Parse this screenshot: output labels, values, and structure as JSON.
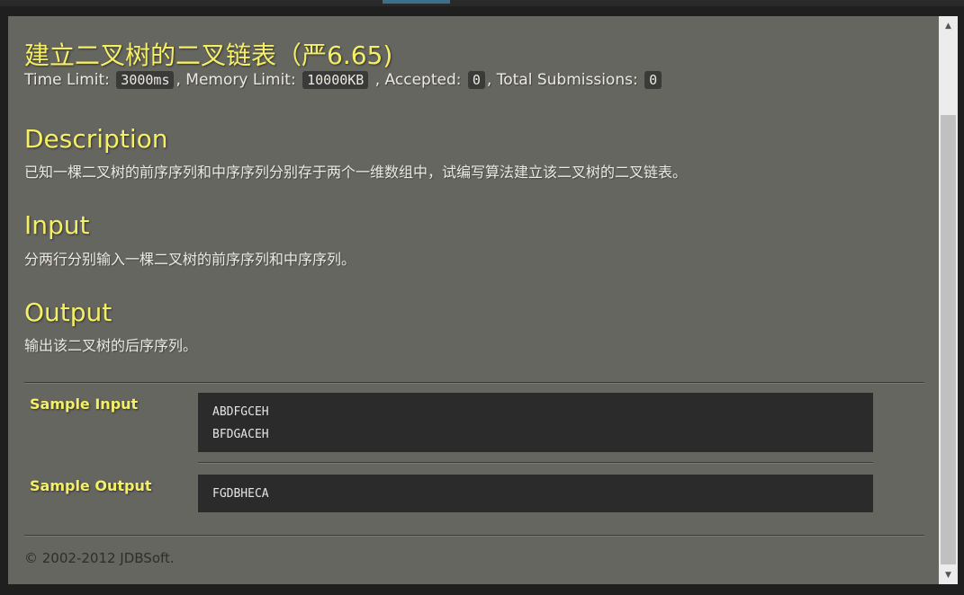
{
  "problem": {
    "title": "建立二叉树的二叉链表（严6.65)",
    "time_limit_label": "Time Limit:",
    "time_limit": "3000ms",
    "memory_limit_label": ", Memory Limit:",
    "memory_limit": "10000KB",
    "accepted_label": ", Accepted:",
    "accepted": "0",
    "total_label": ", Total Submissions:",
    "total": "0"
  },
  "sections": {
    "description_heading": "Description",
    "description_text": "已知一棵二叉树的前序序列和中序序列分别存于两个一维数组中，试编写算法建立该二叉树的二叉链表。",
    "input_heading": "Input",
    "input_text": "分两行分别输入一棵二叉树的前序序列和中序序列。",
    "output_heading": "Output",
    "output_text": "输出该二叉树的后序序列。"
  },
  "samples": {
    "input_label": "Sample Input",
    "input_lines": [
      "ABDFGCEH",
      "BFDGACEH"
    ],
    "output_label": "Sample Output",
    "output_lines": [
      "FGDBHECA"
    ]
  },
  "footer": {
    "copyright": "© 2002-2012  JDBSoft."
  },
  "icons": {
    "scroll_up": "scroll-up-arrow-icon",
    "scroll_down": "scroll-down-arrow-icon"
  }
}
